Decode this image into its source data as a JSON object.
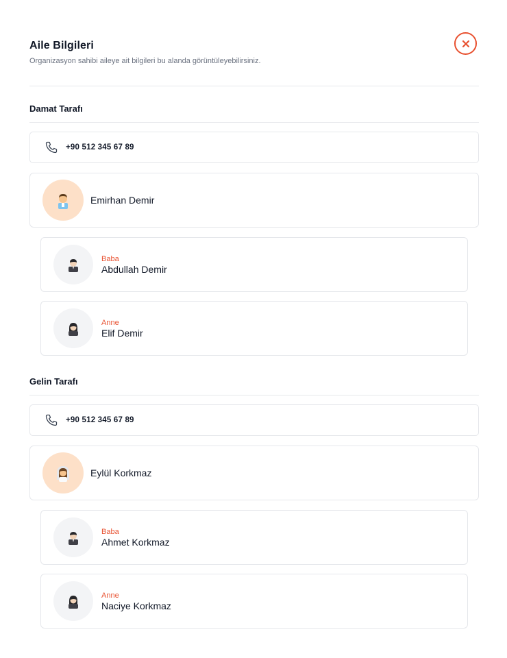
{
  "header": {
    "title": "Aile Bilgileri",
    "subtitle": "Organizasyon sahibi aileye ait bilgileri bu alanda görüntüleyebilirsiniz.",
    "close_icon": "close-circle-icon"
  },
  "groom_side": {
    "section_title": "Damat Tarafı",
    "phone": "+90 512 345 67 89",
    "person": {
      "name": "Emirhan Demir",
      "avatar": "groom-avatar-icon"
    },
    "members": [
      {
        "role": "Baba",
        "name": "Abdullah Demir",
        "avatar": "man-avatar-icon"
      },
      {
        "role": "Anne",
        "name": "Elif Demir",
        "avatar": "woman-avatar-icon"
      }
    ]
  },
  "bride_side": {
    "section_title": "Gelin Tarafı",
    "phone": "+90 512 345 67 89",
    "person": {
      "name": "Eylül Korkmaz",
      "avatar": "bride-avatar-icon"
    },
    "members": [
      {
        "role": "Baba",
        "name": "Ahmet Korkmaz",
        "avatar": "man-avatar-icon"
      },
      {
        "role": "Anne",
        "name": "Naciye Korkmaz",
        "avatar": "woman-avatar-icon"
      }
    ]
  },
  "colors": {
    "accent": "#e8502f",
    "avatar_highlight_bg": "#fde0c8",
    "avatar_bg": "#f3f4f6",
    "border": "#e5e7eb"
  }
}
